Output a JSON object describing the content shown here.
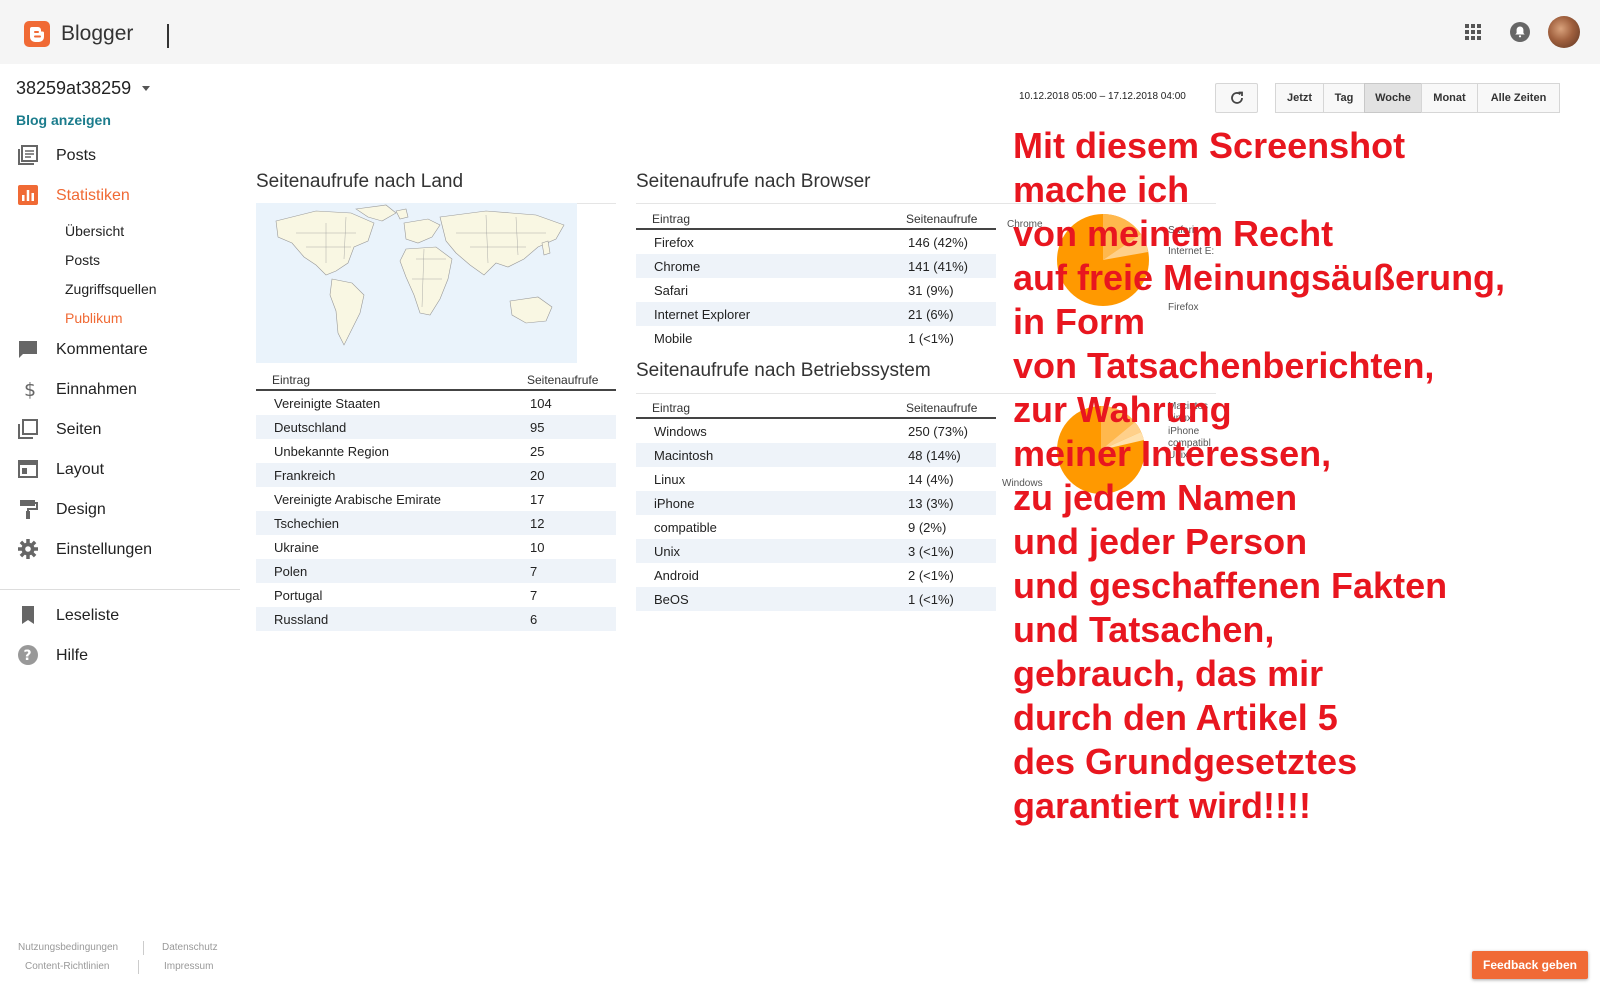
{
  "app": {
    "name": "Blogger"
  },
  "blog": {
    "name": "38259at38259",
    "view_label": "Blog anzeigen"
  },
  "nav": {
    "posts": "Posts",
    "stats": "Statistiken",
    "stats_sub": [
      "Übersicht",
      "Posts",
      "Zugriffsquellen",
      "Publikum"
    ],
    "comments": "Kommentare",
    "earnings": "Einnahmen",
    "pages": "Seiten",
    "layout": "Layout",
    "design": "Design",
    "settings": "Einstellungen",
    "reading_list": "Leseliste",
    "help": "Hilfe"
  },
  "footer": {
    "terms": "Nutzungsbedingungen",
    "privacy": "Datenschutz",
    "content": "Content-Richtlinien",
    "imprint": "Impressum"
  },
  "toolbar": {
    "date_range": "10.12.2018 05:00 – 17.12.2018 04:00",
    "ranges": [
      "Jetzt",
      "Tag",
      "Woche",
      "Monat",
      "Alle Zeiten"
    ],
    "active_range": "Woche"
  },
  "country": {
    "title": "Seitenaufrufe nach Land",
    "col_entry": "Eintrag",
    "col_views": "Seitenaufrufe",
    "rows": [
      [
        "Vereinigte Staaten",
        "104"
      ],
      [
        "Deutschland",
        "95"
      ],
      [
        "Unbekannte Region",
        "25"
      ],
      [
        "Frankreich",
        "20"
      ],
      [
        "Vereinigte Arabische Emirate",
        "17"
      ],
      [
        "Tschechien",
        "12"
      ],
      [
        "Ukraine",
        "10"
      ],
      [
        "Polen",
        "7"
      ],
      [
        "Portugal",
        "7"
      ],
      [
        "Russland",
        "6"
      ]
    ]
  },
  "browser": {
    "title": "Seitenaufrufe nach Browser",
    "col_entry": "Eintrag",
    "col_views": "Seitenaufrufe",
    "rows": [
      [
        "Firefox",
        "146 (42%)"
      ],
      [
        "Chrome",
        "141 (41%)"
      ],
      [
        "Safari",
        "31 (9%)"
      ],
      [
        "Internet Explorer",
        "21 (6%)"
      ],
      [
        "Mobile",
        "1 (<1%)"
      ]
    ],
    "pie_labels": {
      "left": "Chrome",
      "right1": "Safari",
      "right2": "Internet E:",
      "bottom": "Firefox"
    }
  },
  "os": {
    "title": "Seitenaufrufe nach Betriebssystem",
    "col_entry": "Eintrag",
    "col_views": "Seitenaufrufe",
    "rows": [
      [
        "Windows",
        "250 (73%)"
      ],
      [
        "Macintosh",
        "48 (14%)"
      ],
      [
        "Linux",
        "14 (4%)"
      ],
      [
        "iPhone",
        "13 (3%)"
      ],
      [
        "compatible",
        "9 (2%)"
      ],
      [
        "Unix",
        "3 (<1%)"
      ],
      [
        "Android",
        "2 (<1%)"
      ],
      [
        "BeOS",
        "1 (<1%)"
      ]
    ],
    "pie_labels": {
      "r1": "Macintos",
      "r2": "Linux",
      "r3": "iPhone",
      "r4": "compatibl",
      "r5": "Unix",
      "left": "Windows"
    }
  },
  "colors": {
    "accent": "#f06a35",
    "pie": "#ff9900",
    "overlay": "#e8161f",
    "link": "#1b7c8c"
  },
  "overlay_lines": [
    "Mit diesem Screenshot",
    "mache ich",
    "von meinem Recht",
    "auf freie Meinungsäußerung,",
    "in Form",
    "von Tatsachenberichten,",
    "zur Wahrung",
    "meiner Interessen,",
    "zu jedem Namen",
    "und jeder Person",
    "und geschaffenen Fakten",
    "und Tatsachen,",
    "gebrauch, das mir",
    "durch den Artikel 5",
    "des Grundgesetztes",
    "garantiert wird!!!!"
  ],
  "feedback": "Feedback geben"
}
